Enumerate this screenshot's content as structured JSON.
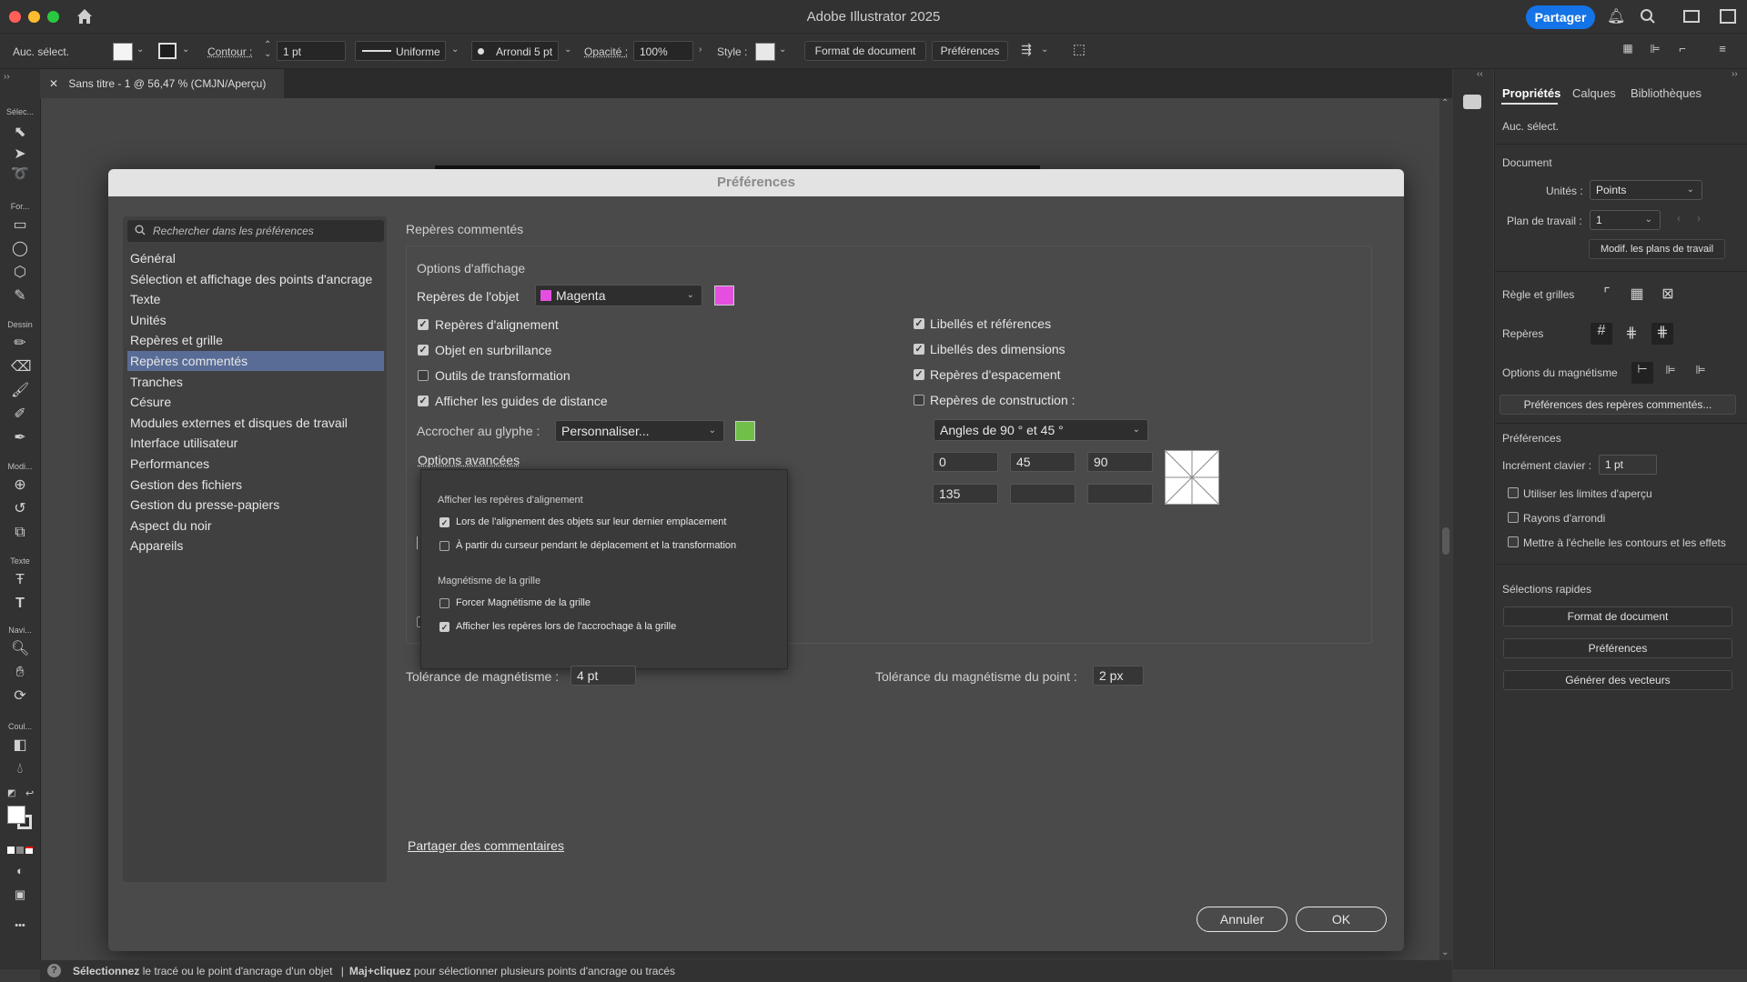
{
  "app": {
    "title": "Adobe Illustrator 2025",
    "share_label": "Partager"
  },
  "control_bar": {
    "selection": "Auc. sélect.",
    "stroke_label": "Contour :",
    "stroke_value": "1 pt",
    "stroke_profile": "Uniforme",
    "brush": "Arrondi 5 pt",
    "opacity_label": "Opacité :",
    "opacity_value": "100%",
    "style_label": "Style :",
    "doc_setup_label": "Format de document",
    "prefs_label": "Préférences"
  },
  "document_tab": {
    "label": "Sans titre - 1 @ 56,47 % (CMJN/Aperçu)"
  },
  "toolbar": {
    "categories": [
      "Sélec...",
      "For...",
      "Dessin",
      "Modi...",
      "Texte",
      "Navi...",
      "Coul..."
    ],
    "more": "•••"
  },
  "dialog": {
    "title": "Préférences",
    "search_placeholder": "Rechercher dans les préférences",
    "categories": [
      "Général",
      "Sélection et affichage des points d'ancrage",
      "Texte",
      "Unités",
      "Repères et grille",
      "Repères commentés",
      "Tranches",
      "Césure",
      "Modules externes et disques de travail",
      "Interface utilisateur",
      "Performances",
      "Gestion des fichiers",
      "Gestion du presse-papiers",
      "Aspect du noir",
      "Appareils"
    ],
    "selected_category": 5,
    "section_title": "Repères commentés",
    "display_options_title": "Options d'affichage",
    "object_guides_label": "Repères de l'objet",
    "object_guides_color": "Magenta",
    "object_guides_swatch": "#e44fe0",
    "left_options": [
      {
        "label": "Repères d'alignement",
        "checked": true
      },
      {
        "label": "Objet en surbrillance",
        "checked": true
      },
      {
        "label": "Outils de transformation",
        "checked": false
      },
      {
        "label": "Afficher les guides de distance",
        "checked": true
      }
    ],
    "right_options": [
      {
        "label": "Libellés et références",
        "checked": true
      },
      {
        "label": "Libellés des dimensions",
        "checked": true
      },
      {
        "label": "Repères d'espacement",
        "checked": true
      },
      {
        "label": "Repères de construction :",
        "checked": false
      }
    ],
    "glyph_snap_label": "Accrocher au glyphe :",
    "glyph_snap_value": "Personnaliser...",
    "glyph_snap_swatch": "#6fbf48",
    "angles_value": "Angles de 90 ° et 45 °",
    "angles": [
      "0",
      "45",
      "90",
      "135",
      "",
      ""
    ],
    "advanced_label": "Options avancées",
    "popup": {
      "align_header": "Afficher les repères d'alignement",
      "align_opt1": "Lors de l'alignement des objets sur leur dernier emplacement",
      "align_opt1_checked": true,
      "align_opt2": "À partir du curseur pendant le déplacement et la transformation",
      "align_opt2_checked": false,
      "grid_header": "Magnétisme de la grille",
      "grid_opt1": "Forcer Magnétisme de la grille",
      "grid_opt1_checked": false,
      "grid_opt2": "Afficher les repères lors de l'accrochage à la grille",
      "grid_opt2_checked": true
    },
    "snap_tolerance_label": "Tolérance de magnétisme :",
    "snap_tolerance_value": "4 pt",
    "point_snap_label": "Tolérance du magnétisme du point :",
    "point_snap_value": "2 px",
    "share_comments": "Partager des commentaires",
    "cancel": "Annuler",
    "ok": "OK"
  },
  "properties": {
    "tabs": [
      "Propriétés",
      "Calques",
      "Bibliothèques"
    ],
    "selection": "Auc. sélect.",
    "document_header": "Document",
    "units_label": "Unités :",
    "units_value": "Points",
    "artboard_label": "Plan de travail :",
    "artboard_value": "1",
    "edit_artboards": "Modif. les plans de travail",
    "rulers_label": "Règle et grilles",
    "guides_label": "Repères",
    "snap_label": "Options du magnétisme",
    "smart_guides_prefs": "Préférences des repères commentés...",
    "prefs_header": "Préférences",
    "key_increment_label": "Incrément clavier :",
    "key_increment_value": "1 pt",
    "checks": [
      "Utiliser les limites d'aperçu",
      "Rayons d'arrondi",
      "Mettre à l'échelle les contours et les effets"
    ],
    "quick_actions_header": "Sélections rapides",
    "quick_actions": [
      "Format de document",
      "Préférences",
      "Générer des vecteurs"
    ]
  },
  "status_bar": {
    "part1_bold": "Sélectionnez",
    "part1": " le tracé ou le point d'ancrage d'un objet",
    "sep": "|",
    "part2_bold": "Maj+cliquez",
    "part2": " pour sélectionner plusieurs points d'ancrage ou tracés"
  }
}
